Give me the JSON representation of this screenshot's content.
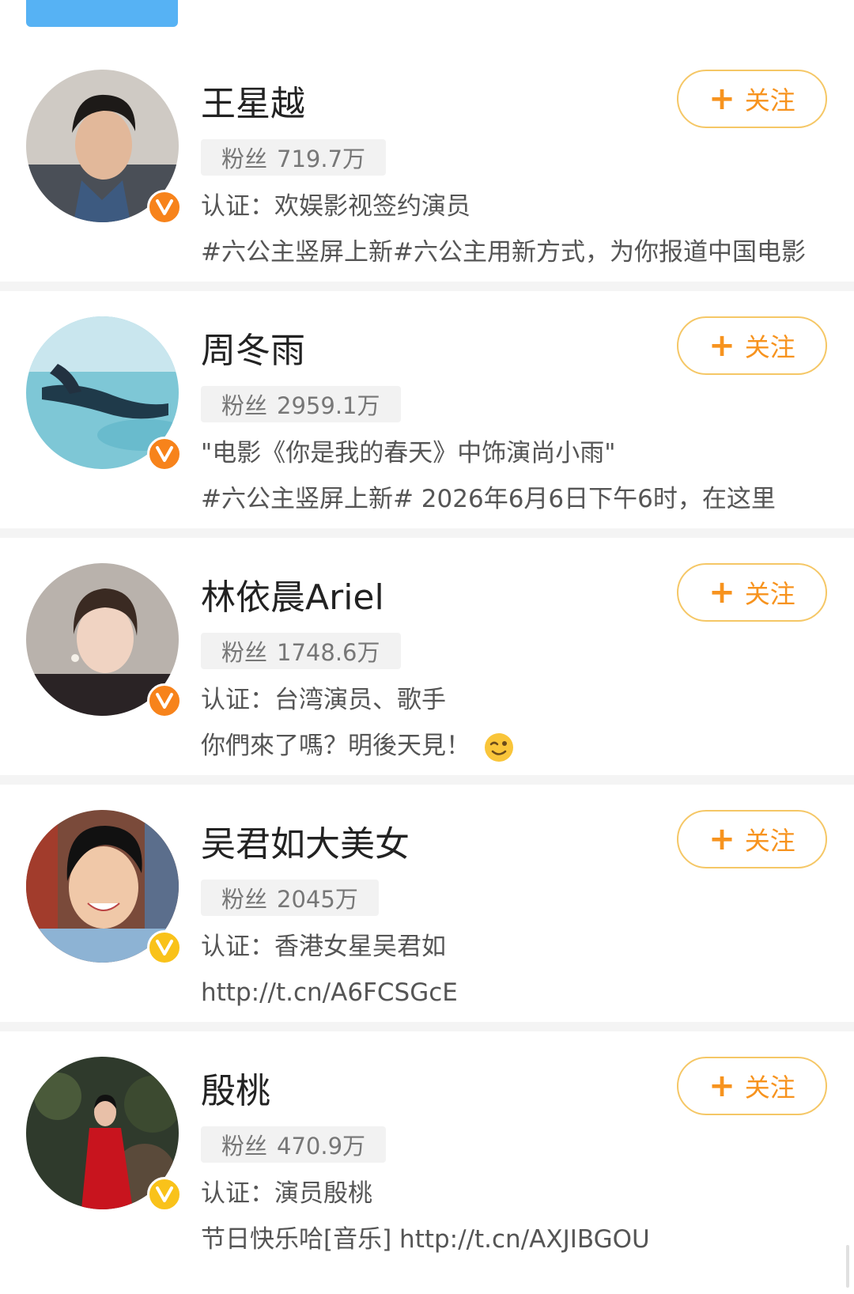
{
  "follow_label": "关注",
  "follow_icon": "plus-icon",
  "fans_label": "粉丝",
  "colors": {
    "accent_orange": "#f7931e",
    "follow_border": "#f5c766",
    "verified_orange": "#f7831b",
    "verified_gold": "#f9c21a",
    "top_tab": "#56b2f4"
  },
  "users": [
    {
      "name": "王星越",
      "fans": "719.7万",
      "line1": "认证：欢娱影视签约演员",
      "line2": "#六公主竖屏上新#六公主用新方式，为你报道中国电影",
      "badge": "verified-orange"
    },
    {
      "name": "周冬雨",
      "fans": "2959.1万",
      "line1": "\"电影《你是我的春天》中饰演尚小雨\"",
      "line2": "#六公主竖屏上新# 2026年6月6日下午6时，在这里",
      "badge": "verified-orange"
    },
    {
      "name": "林依晨Ariel",
      "fans": "1748.6万",
      "line1": "认证：台湾演员、歌手",
      "line2": "你們來了嗎？明後天見！",
      "badge": "verified-orange",
      "emoji": "wink-emoji"
    },
    {
      "name": "吴君如大美女",
      "fans": "2045万",
      "line1": "认证：香港女星吴君如",
      "line2": "http://t.cn/A6FCSGcE",
      "badge": "verified-gold"
    },
    {
      "name": "殷桃",
      "fans": "470.9万",
      "line1": "认证：演员殷桃",
      "line2": "节日快乐哈[音乐] http://t.cn/AXJIBGOU",
      "badge": "verified-gold"
    }
  ]
}
